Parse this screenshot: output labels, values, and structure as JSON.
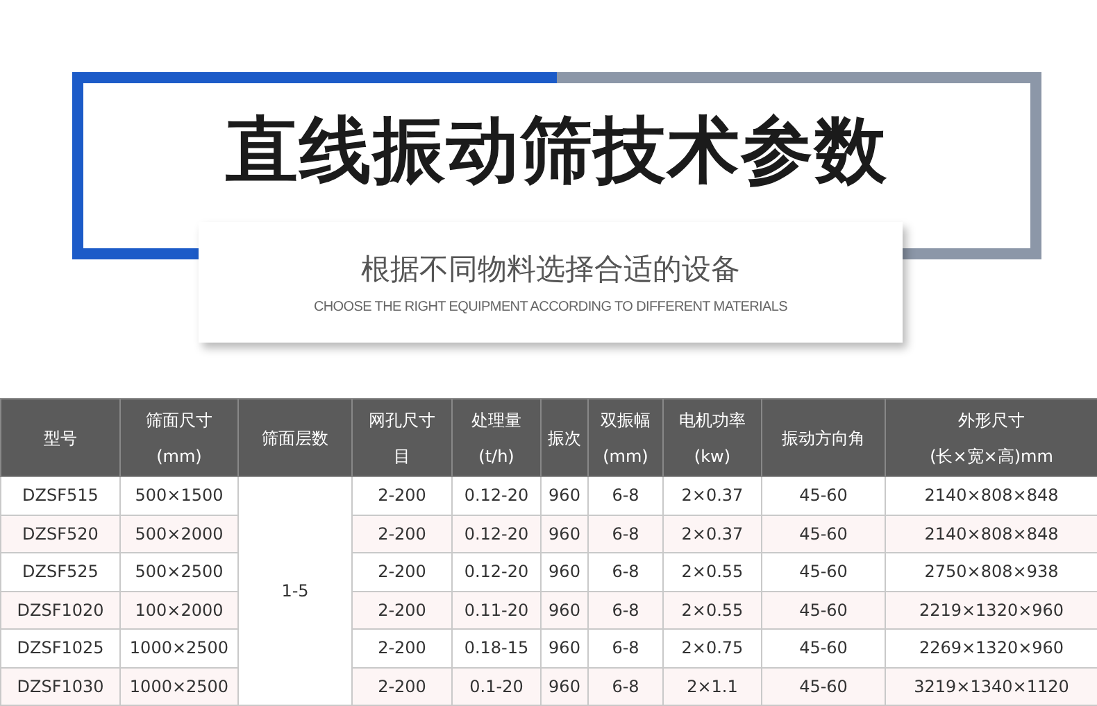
{
  "banner": {
    "title": "直线振动筛技术参数",
    "subtitle": "根据不同物料选择合适的设备",
    "subtitle_en": "CHOOSE THE RIGHT EQUIPMENT ACCORDING TO DIFFERENT MATERIALS"
  },
  "table": {
    "columns": [
      {
        "lines": [
          "型号"
        ]
      },
      {
        "lines": [
          "筛面尺寸",
          "(mm)"
        ]
      },
      {
        "lines": [
          "筛面层数"
        ]
      },
      {
        "lines": [
          "网孔尺寸",
          "目"
        ]
      },
      {
        "lines": [
          "处理量",
          "(t/h)"
        ]
      },
      {
        "lines": [
          "振次"
        ]
      },
      {
        "lines": [
          "双振幅",
          "(mm)"
        ]
      },
      {
        "lines": [
          "电机功率",
          "(kw)"
        ]
      },
      {
        "lines": [
          "振动方向角"
        ]
      },
      {
        "lines": [
          "外形尺寸",
          "(长×宽×高)mm"
        ]
      }
    ],
    "rows": [
      {
        "cells": [
          "DZSF515",
          "500×1500",
          {
            "text": "1-5",
            "rowspan": 6
          },
          "2-200",
          "0.12-20",
          "960",
          "6-8",
          "2×0.37",
          "45-60",
          "2140×808×848"
        ]
      },
      {
        "cells": [
          "DZSF520",
          "500×2000",
          "2-200",
          "0.12-20",
          "960",
          "6-8",
          "2×0.37",
          "45-60",
          "2140×808×848"
        ]
      },
      {
        "cells": [
          "DZSF525",
          "500×2500",
          "2-200",
          "0.12-20",
          "960",
          "6-8",
          "2×0.55",
          "45-60",
          "2750×808×938"
        ]
      },
      {
        "cells": [
          "DZSF1020",
          "100×2000",
          "2-200",
          "0.11-20",
          "960",
          "6-8",
          "2×0.55",
          "45-60",
          "2219×1320×960"
        ]
      },
      {
        "cells": [
          "DZSF1025",
          "1000×2500",
          "2-200",
          "0.18-15",
          "960",
          "6-8",
          "2×0.75",
          "45-60",
          "2269×1320×960"
        ]
      },
      {
        "cells": [
          "DZSF1030",
          "1000×2500",
          "2-200",
          "0.1-20",
          "960",
          "6-8",
          "2×1.1",
          "45-60",
          "3219×1340×1120"
        ]
      }
    ]
  }
}
